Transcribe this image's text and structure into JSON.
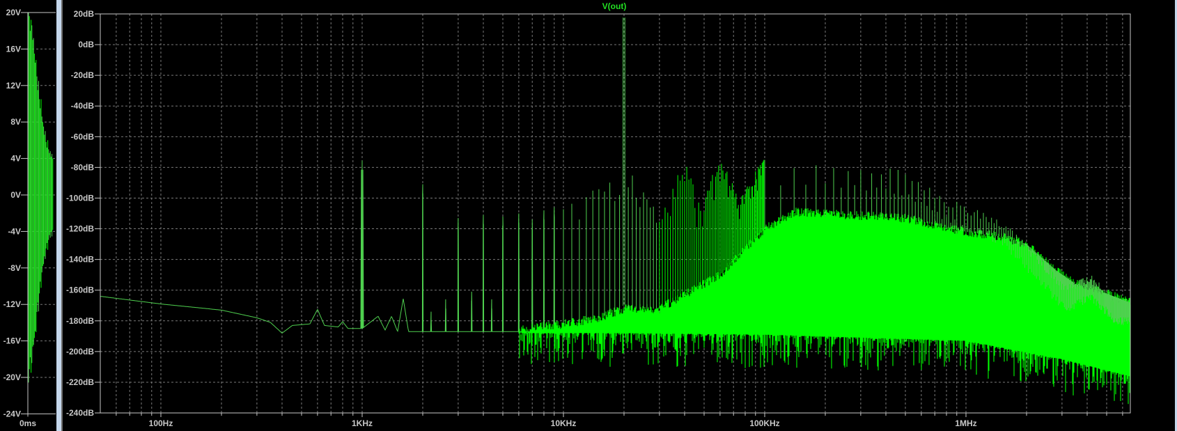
{
  "colors": {
    "background": "#000000",
    "axis": "#c8c8c8",
    "grid": "#7a7a7a",
    "trace_line": "#4fd14f",
    "trace_fill": "#00ff00",
    "title": "#22e022",
    "pane_separator": "#c5d7ec"
  },
  "left_pane": {
    "chart_data": {
      "type": "line",
      "title": "",
      "xlabel": "",
      "ylabel": "",
      "x_tick_labels": [
        "0ms"
      ],
      "y_tick_values": [
        20,
        16,
        12,
        8,
        4,
        0,
        -4,
        -8,
        -12,
        -16,
        -20,
        -24
      ],
      "y_tick_labels": [
        "20V",
        "16V",
        "12V",
        "8V",
        "4V",
        "0V",
        "-4V",
        "-8V",
        "-12V",
        "-16V",
        "-20V",
        "-24V"
      ],
      "ylim": [
        -24,
        20
      ],
      "grid": true,
      "oscillation_amplitude_envelope_V": [
        20,
        19.6,
        18,
        19.2,
        18.6,
        17,
        17.2,
        15.5,
        14.5,
        14.8,
        13,
        11.5,
        12.5,
        10.5,
        9.5,
        10.5,
        8.6,
        8,
        7.5,
        6.6,
        7,
        5.8,
        5.2,
        6,
        5,
        4.6,
        4.8,
        4.2,
        4.5,
        4
      ]
    }
  },
  "right_pane": {
    "chart_data": {
      "type": "line",
      "title": "V(out)",
      "xlabel": "",
      "ylabel": "",
      "xscale": "log",
      "xlim_hz": [
        50,
        6500000
      ],
      "ylim_db": [
        -240,
        20
      ],
      "grid": true,
      "x_tick_values": [
        100,
        1000,
        10000,
        100000,
        1000000
      ],
      "x_tick_labels": [
        "100Hz",
        "1KHz",
        "10KHz",
        "100KHz",
        "1MHz"
      ],
      "y_tick_values": [
        20,
        0,
        -20,
        -40,
        -60,
        -80,
        -100,
        -120,
        -140,
        -160,
        -180,
        -200,
        -220,
        -240
      ],
      "y_tick_labels": [
        "20dB",
        "0dB",
        "-20dB",
        "-40dB",
        "-60dB",
        "-80dB",
        "-100dB",
        "-120dB",
        "-140dB",
        "-160dB",
        "-180dB",
        "-200dB",
        "-220dB",
        "-240dB"
      ],
      "series": [
        {
          "name": "V(out)",
          "floor_hz_db": [
            [
              50,
              -164
            ],
            [
              100,
              -169
            ],
            [
              200,
              -173
            ],
            [
              300,
              -178
            ],
            [
              350,
              -181
            ],
            [
              400,
              -188
            ],
            [
              450,
              -183
            ],
            [
              550,
              -182
            ],
            [
              600,
              -172.5
            ],
            [
              650,
              -183
            ],
            [
              760,
              -184
            ],
            [
              800,
              -180.5
            ],
            [
              850,
              -185
            ],
            [
              1000,
              -185
            ],
            [
              1200,
              -177
            ],
            [
              1300,
              -186
            ],
            [
              1400,
              -177
            ],
            [
              1500,
              -187
            ],
            [
              1600,
              -165.6
            ],
            [
              1700,
              -187
            ],
            [
              10000,
              -187
            ],
            [
              20000,
              -186
            ],
            [
              100000,
              -189
            ],
            [
              6500000,
              -192
            ]
          ],
          "low_harmonic_peaks_hz_db": [
            [
              1000,
              -75.5
            ],
            [
              2000,
              -91
            ],
            [
              2200,
              -174
            ],
            [
              2600,
              -166
            ],
            [
              3000,
              -113
            ],
            [
              3500,
              -161
            ],
            [
              4000,
              -111
            ],
            [
              4400,
              -166
            ],
            [
              5000,
              -112
            ],
            [
              6000,
              -110
            ],
            [
              7000,
              -114
            ],
            [
              8000,
              -108
            ],
            [
              9000,
              -106
            ]
          ],
          "fundamental_hz_db": [
            [
              19800,
              17.6
            ],
            [
              20200,
              17.6
            ]
          ],
          "noise_top_hz_db": [
            [
              6000,
              -186
            ],
            [
              10000,
              -182
            ],
            [
              15000,
              -178
            ],
            [
              20000,
              -172
            ],
            [
              30000,
              -172
            ],
            [
              60000,
              -150
            ],
            [
              100000,
              -120
            ],
            [
              140000,
              -109
            ],
            [
              500000,
              -113
            ],
            [
              1000000,
              -122
            ],
            [
              1500000,
              -125
            ],
            [
              2000000,
              -130
            ],
            [
              2800000,
              -147
            ],
            [
              3500000,
              -156
            ],
            [
              4500000,
              -160
            ],
            [
              6500000,
              -168
            ]
          ],
          "noise_bottom_hz_db": [
            [
              6000,
              -188
            ],
            [
              20000,
              -188
            ],
            [
              100000,
              -189
            ],
            [
              1000000,
              -193
            ],
            [
              3000000,
              -205
            ],
            [
              6500000,
              -216
            ]
          ],
          "spike_envelope_hz_db": [
            [
              10000,
              -106
            ],
            [
              19000,
              -85
            ],
            [
              21000,
              -81.5
            ],
            [
              30000,
              -110
            ],
            [
              40000,
              -75.5
            ],
            [
              48000,
              -105
            ],
            [
              60000,
              -72
            ],
            [
              75000,
              -100
            ],
            [
              100000,
              -72
            ],
            [
              138000,
              -75.5
            ],
            [
              450000,
              -80
            ],
            [
              826000,
              -100
            ],
            [
              1500000,
              -113
            ],
            [
              2350000,
              -139
            ],
            [
              3100000,
              -157
            ],
            [
              4200000,
              -150
            ],
            [
              5700000,
              -166
            ],
            [
              6500000,
              -165
            ]
          ],
          "spike_spacing_hz": {
            "below_100k": 1000,
            "above_100k": 20000
          }
        }
      ]
    }
  }
}
